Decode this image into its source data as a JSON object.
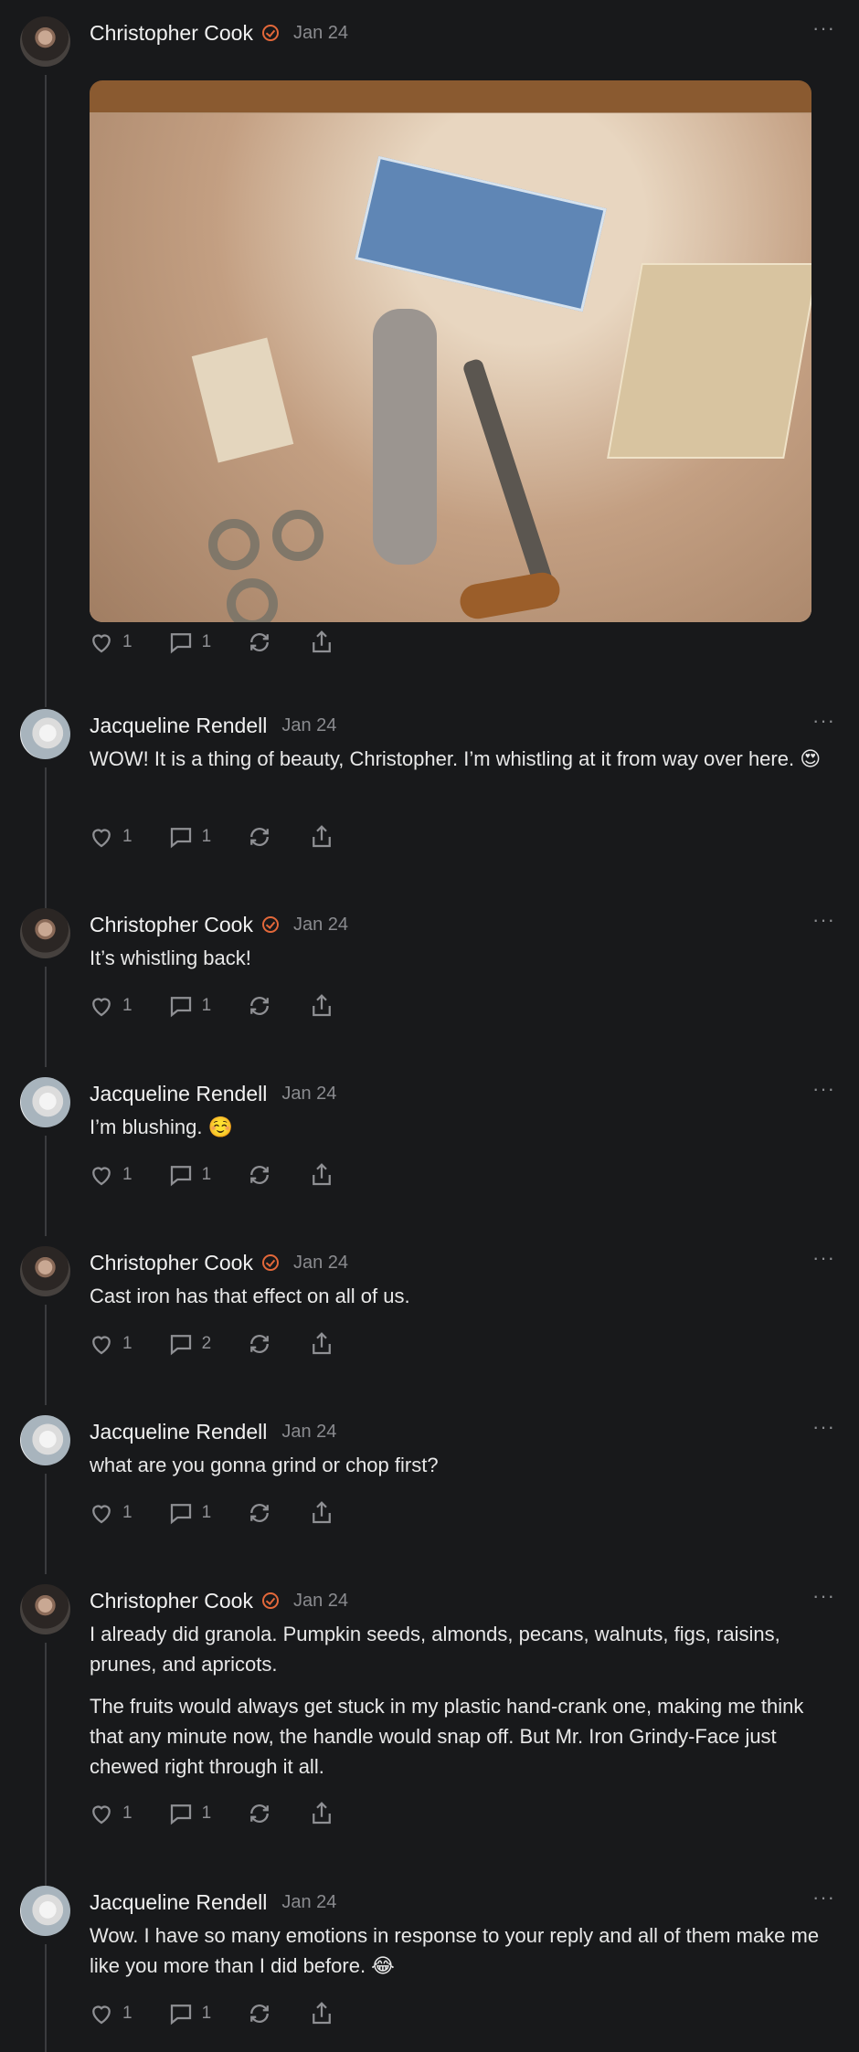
{
  "posts": [
    {
      "author": "Christopher Cook",
      "date": "Jan 24",
      "paragraphs": [],
      "likes": "1",
      "replies": "1",
      "image": "meat-grinder-photo"
    },
    {
      "author": "Jacqueline Rendell",
      "date": "Jan 24",
      "paragraphs": [
        "WOW! It is a thing of beauty, Christopher. I’m whistling at it from way over here. 😍"
      ],
      "likes": "1",
      "replies": "1"
    },
    {
      "author": "Christopher Cook",
      "date": "Jan 24",
      "paragraphs": [
        "It’s whistling back!"
      ],
      "likes": "1",
      "replies": "1"
    },
    {
      "author": "Jacqueline Rendell",
      "date": "Jan 24",
      "paragraphs": [
        "I’m blushing. ☺️"
      ],
      "likes": "1",
      "replies": "1"
    },
    {
      "author": "Christopher Cook",
      "date": "Jan 24",
      "paragraphs": [
        "Cast iron has that effect on all of us."
      ],
      "likes": "1",
      "replies": "2"
    },
    {
      "author": "Jacqueline Rendell",
      "date": "Jan 24",
      "paragraphs": [
        "what are you gonna grind or chop first?"
      ],
      "likes": "1",
      "replies": "1"
    },
    {
      "author": "Christopher Cook",
      "date": "Jan 24",
      "paragraphs": [
        "I already did granola. Pumpkin seeds, almonds, pecans, walnuts, figs, raisins, prunes, and apricots.",
        "The fruits would always get stuck in my plastic hand-crank one, making me think that any minute now, the handle would snap off. But Mr. Iron Grindy-Face just chewed right through it all."
      ],
      "likes": "1",
      "replies": "1"
    },
    {
      "author": "Jacqueline Rendell",
      "date": "Jan 24",
      "paragraphs": [
        "Wow. I have so many emotions in response to your reply and all of them make me like you more than I did before. 😂"
      ],
      "likes": "1",
      "replies": "1"
    }
  ],
  "more_glyph": "···",
  "colors": {
    "background": "#18191b",
    "verified": "#e3683a",
    "muted": "#8a8b8f"
  }
}
